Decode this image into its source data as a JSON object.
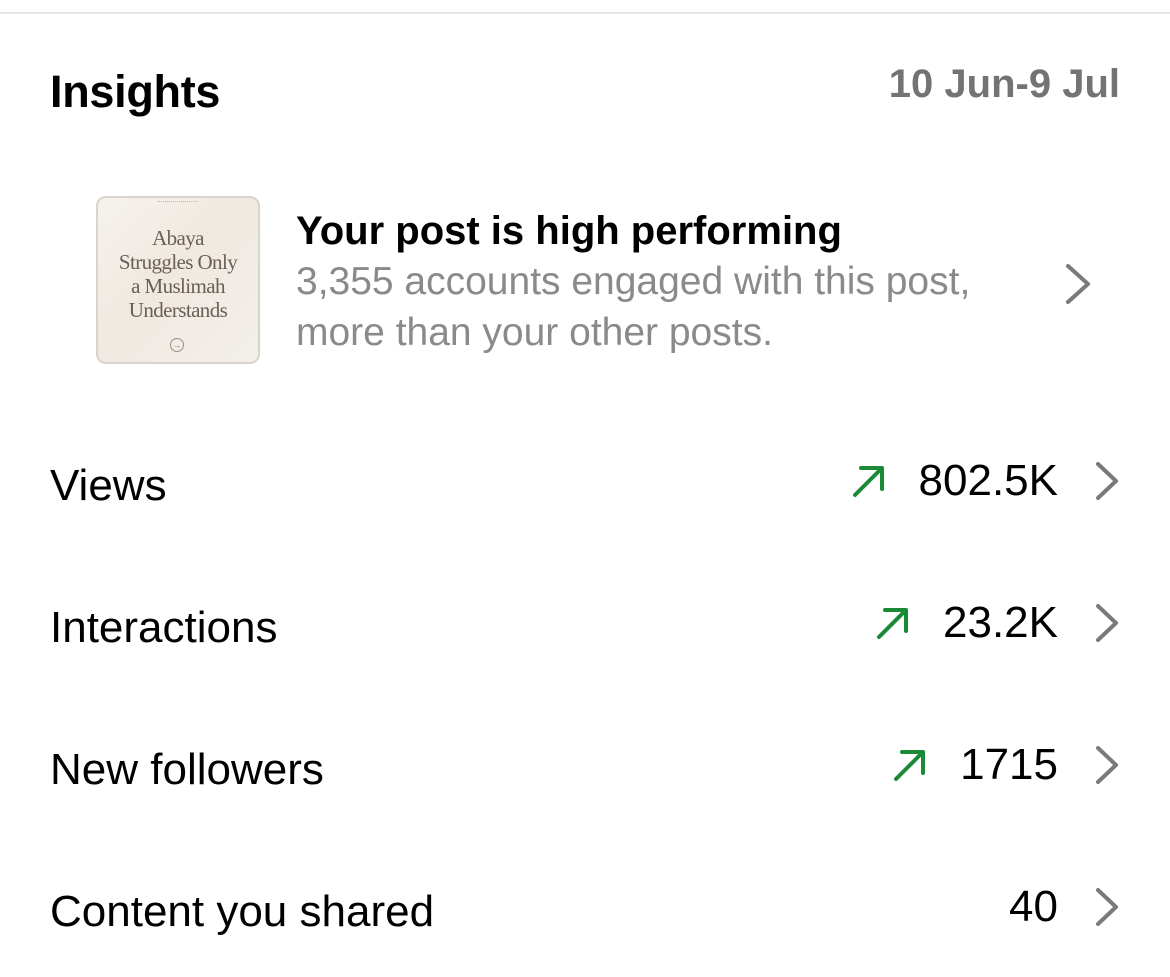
{
  "header": {
    "title": "Insights",
    "date_range": "10 Jun-9 Jul"
  },
  "highlight": {
    "thumbnail_text": "Abaya\nStruggles Only\na Muslimah\nUnderstands",
    "title": "Your post is high performing",
    "body": "3,355 accounts engaged with this post, more than your other posts.",
    "chevron_icon": "chevron-right-icon"
  },
  "rows": [
    {
      "label": "Views",
      "value": "802.5K",
      "trend": "up"
    },
    {
      "label": "Interactions",
      "value": "23.2K",
      "trend": "up"
    },
    {
      "label": "New followers",
      "value": "1715",
      "trend": "up"
    },
    {
      "label": "Content you shared",
      "value": "40",
      "trend": "none"
    }
  ],
  "colors": {
    "trend_up": "#1a8a36",
    "secondary_text": "#8a8a8a",
    "date_text": "#737373",
    "chevron": "#7a7a7a"
  }
}
